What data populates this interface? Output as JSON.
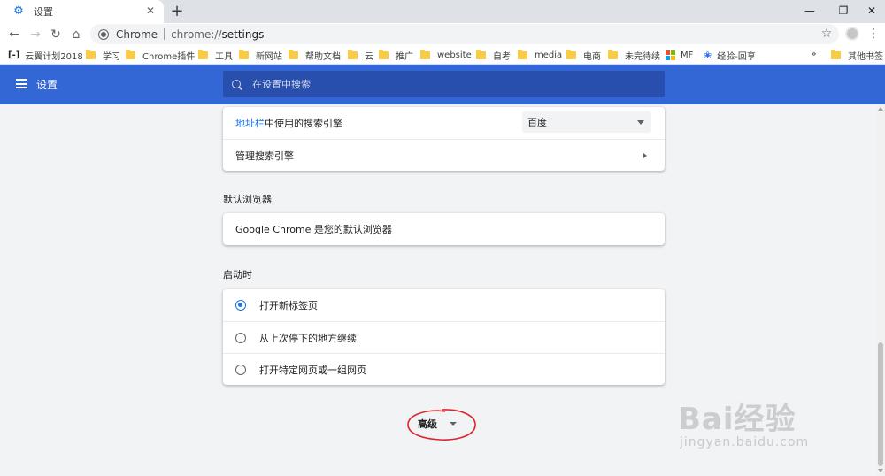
{
  "tab": {
    "title": "设置",
    "favicon": "gear-icon"
  },
  "toolbar": {
    "url_chip": "Chrome",
    "url_scheme": "chrome://",
    "url_host": "settings"
  },
  "bookmarks": {
    "items": [
      {
        "label": "云翼计划2018",
        "icon": "cloud-logo-icon"
      },
      {
        "label": "学习",
        "icon": "folder-icon"
      },
      {
        "label": "Chrome插件",
        "icon": "folder-icon"
      },
      {
        "label": "工具",
        "icon": "folder-icon"
      },
      {
        "label": "新网站",
        "icon": "folder-icon"
      },
      {
        "label": "帮助文档",
        "icon": "folder-icon"
      },
      {
        "label": "云",
        "icon": "folder-icon"
      },
      {
        "label": "推广",
        "icon": "folder-icon"
      },
      {
        "label": "website",
        "icon": "folder-icon"
      },
      {
        "label": "自考",
        "icon": "folder-icon"
      },
      {
        "label": "media",
        "icon": "folder-icon"
      },
      {
        "label": "电商",
        "icon": "folder-icon"
      },
      {
        "label": "未完待续",
        "icon": "folder-icon"
      },
      {
        "label": "MF",
        "icon": "microsoft-icon"
      },
      {
        "label": "经验-回享",
        "icon": "baidu-paw-icon"
      }
    ],
    "overflow": "»",
    "other": "其他书签"
  },
  "header": {
    "title": "设置",
    "search_placeholder": "在设置中搜索"
  },
  "search_engine_card": {
    "address_bar_link": "地址栏",
    "address_bar_rest": "中使用的搜索引擎",
    "selected_engine": "百度",
    "manage_label": "管理搜索引擎"
  },
  "default_browser": {
    "section_title": "默认浏览器",
    "status": "Google Chrome 是您的默认浏览器"
  },
  "on_startup": {
    "section_title": "启动时",
    "options": [
      {
        "label": "打开新标签页",
        "checked": true
      },
      {
        "label": "从上次停下的地方继续",
        "checked": false
      },
      {
        "label": "打开特定网页或一组网页",
        "checked": false
      }
    ]
  },
  "advanced": {
    "label": "高级"
  },
  "watermark": {
    "main": "Bai经验",
    "sub": "jingyan.baidu.com"
  },
  "colors": {
    "header": "#3367d6",
    "accent": "#1a73e8",
    "annotation": "#e0232e"
  }
}
